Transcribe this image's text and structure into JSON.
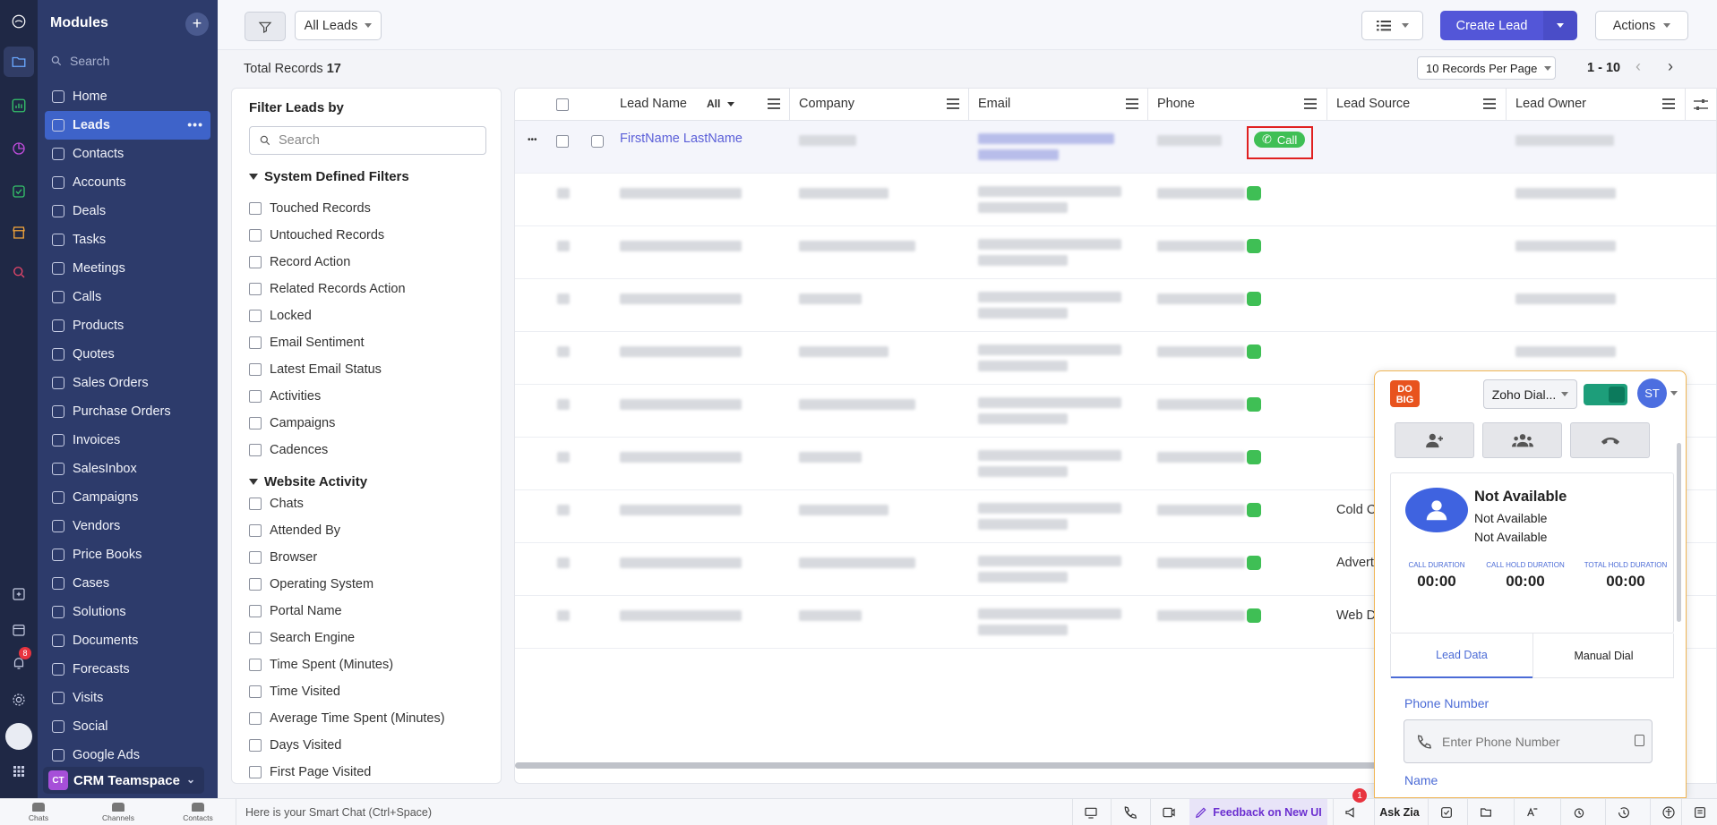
{
  "modules": {
    "title": "Modules",
    "add_label": "+",
    "search_placeholder": "Search",
    "items": [
      {
        "label": "Home"
      },
      {
        "label": "Leads",
        "active": true
      },
      {
        "label": "Contacts"
      },
      {
        "label": "Accounts"
      },
      {
        "label": "Deals"
      },
      {
        "label": "Tasks"
      },
      {
        "label": "Meetings"
      },
      {
        "label": "Calls"
      },
      {
        "label": "Products"
      },
      {
        "label": "Quotes"
      },
      {
        "label": "Sales Orders"
      },
      {
        "label": "Purchase Orders"
      },
      {
        "label": "Invoices"
      },
      {
        "label": "SalesInbox"
      },
      {
        "label": "Campaigns"
      },
      {
        "label": "Vendors"
      },
      {
        "label": "Price Books"
      },
      {
        "label": "Cases"
      },
      {
        "label": "Solutions"
      },
      {
        "label": "Documents"
      },
      {
        "label": "Forecasts"
      },
      {
        "label": "Visits"
      },
      {
        "label": "Social"
      },
      {
        "label": "Google Ads"
      }
    ],
    "more": "•••",
    "teamspace": {
      "initials": "CT",
      "label": "CRM Teamspace"
    },
    "notification_count": "8"
  },
  "toolbar": {
    "view_label": "All Leads",
    "create_label": "Create Lead",
    "actions_label": "Actions",
    "accent": "#5356d8"
  },
  "records": {
    "total_label": "Total Records",
    "total_value": "17",
    "per_page": "10 Records Per Page",
    "range": "1 - 10"
  },
  "filters": {
    "title": "Filter Leads by",
    "search_placeholder": "Search",
    "system_title": "System Defined Filters",
    "system": [
      "Touched Records",
      "Untouched Records",
      "Record Action",
      "Related Records Action",
      "Locked",
      "Email Sentiment",
      "Latest Email Status",
      "Activities",
      "Campaigns",
      "Cadences"
    ],
    "website_title": "Website Activity",
    "website": [
      "Chats",
      "Attended By",
      "Browser",
      "Operating System",
      "Portal Name",
      "Search Engine",
      "Time Spent (Minutes)",
      "Time Visited",
      "Average Time Spent (Minutes)",
      "Days Visited",
      "First Page Visited"
    ]
  },
  "table": {
    "columns": [
      "Lead Name",
      "Company",
      "Email",
      "Phone",
      "Lead Source",
      "Lead Owner"
    ],
    "lead_name_filter": "All",
    "first_row_name": "FirstName LastName",
    "call_label": "Call",
    "lead_sources": [
      "",
      "",
      "",
      "",
      "",
      "",
      "",
      "Cold C",
      "Advert",
      "Web D"
    ]
  },
  "dialer": {
    "logo": "DO BIG",
    "provider": "Zoho Dial...",
    "avatar": "ST",
    "status": "Not Available",
    "line1": "Not Available",
    "line2": "Not Available",
    "durations": [
      {
        "label": "CALL DURATION",
        "value": "00:00"
      },
      {
        "label": "CALL HOLD DURATION",
        "value": "00:00"
      },
      {
        "label": "TOTAL HOLD DURATION",
        "value": "00:00"
      }
    ],
    "tabs": [
      "Lead Data",
      "Manual Dial"
    ],
    "phone_label": "Phone Number",
    "phone_placeholder": "Enter Phone Number",
    "name_label": "Name",
    "toggle_color": "#1d9e7a"
  },
  "bottombar": {
    "nav": [
      "Chats",
      "Channels",
      "Contacts"
    ],
    "smartchat": "Here is your Smart Chat (Ctrl+Space)",
    "feedback": "Feedback on New UI",
    "ask_zia": "Ask Zia",
    "announce_count": "1"
  }
}
